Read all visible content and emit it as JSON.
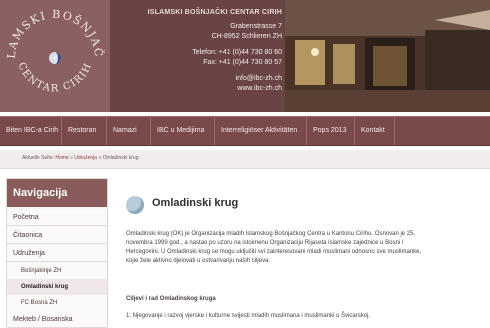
{
  "logo": {
    "ring_top": "ISLAMSKI BOŠNJAČKI",
    "ring_bottom": "CENTAR CIRIH"
  },
  "address": {
    "org": "ISLAMSKI BOŠNJAČKI CENTAR CIRIH",
    "street": "Grabenstrasse 7",
    "city": "CH-8952 Schlieren ZH",
    "telefon": "Telefon: +41 (0)44 730 80 60",
    "fax": "Fax: +41 (0)44 730 80 57",
    "email": "info@ibc-zh.ch",
    "web": "www.ibc-zh.ch"
  },
  "nav": {
    "items": [
      "Biten IBC-a Cirih",
      "Restoran",
      "Namazi",
      "IBC u Medijima",
      "Interreligiöser Aktivitäten",
      "Pops 2013",
      "Kontakt"
    ]
  },
  "breadcrumb": {
    "prefix": "Aktuelle Seite:",
    "home": "Home",
    "sep": "»",
    "level1": "Udruženja",
    "current": "Omladinski krug"
  },
  "sidebar": {
    "title": "Navigacija",
    "items": [
      {
        "label": "Početna"
      },
      {
        "label": "Čitaonica"
      },
      {
        "label": "Udruženja"
      },
      {
        "label": "Bošnjakinje ZH"
      },
      {
        "label": "Omladinski krug"
      },
      {
        "label": "FC Bosna ZH"
      },
      {
        "label": "Mekteb / Bosanska"
      }
    ]
  },
  "main": {
    "title": "Omladinski krug",
    "para": [
      "Omladinski krug (OK) je Organizacija mladih Islamskog Bošnjačkog Centra u Kantonu Cirihu. Osnovan je 25.",
      "novembra 1999 god., a nastao po uzoru na istoimenu Organizaciju Rijaseta islamske zajednice u Bosni i",
      "Hercegovini. U Omladinski krug se mogu uključiti svi zainteresovani mladi muslimani odnosno sve muslimanke,",
      "kojie žele aktivno djelovati u ostvarivanju naših ciljeva."
    ],
    "subtitle": "Ciljevi i rad Omladinskog kruga",
    "list_first": "1.  Njegovanje i razvoj vjerske i kulturne svijesti mladih muslimana i muslimanki u Švicarskoj."
  }
}
